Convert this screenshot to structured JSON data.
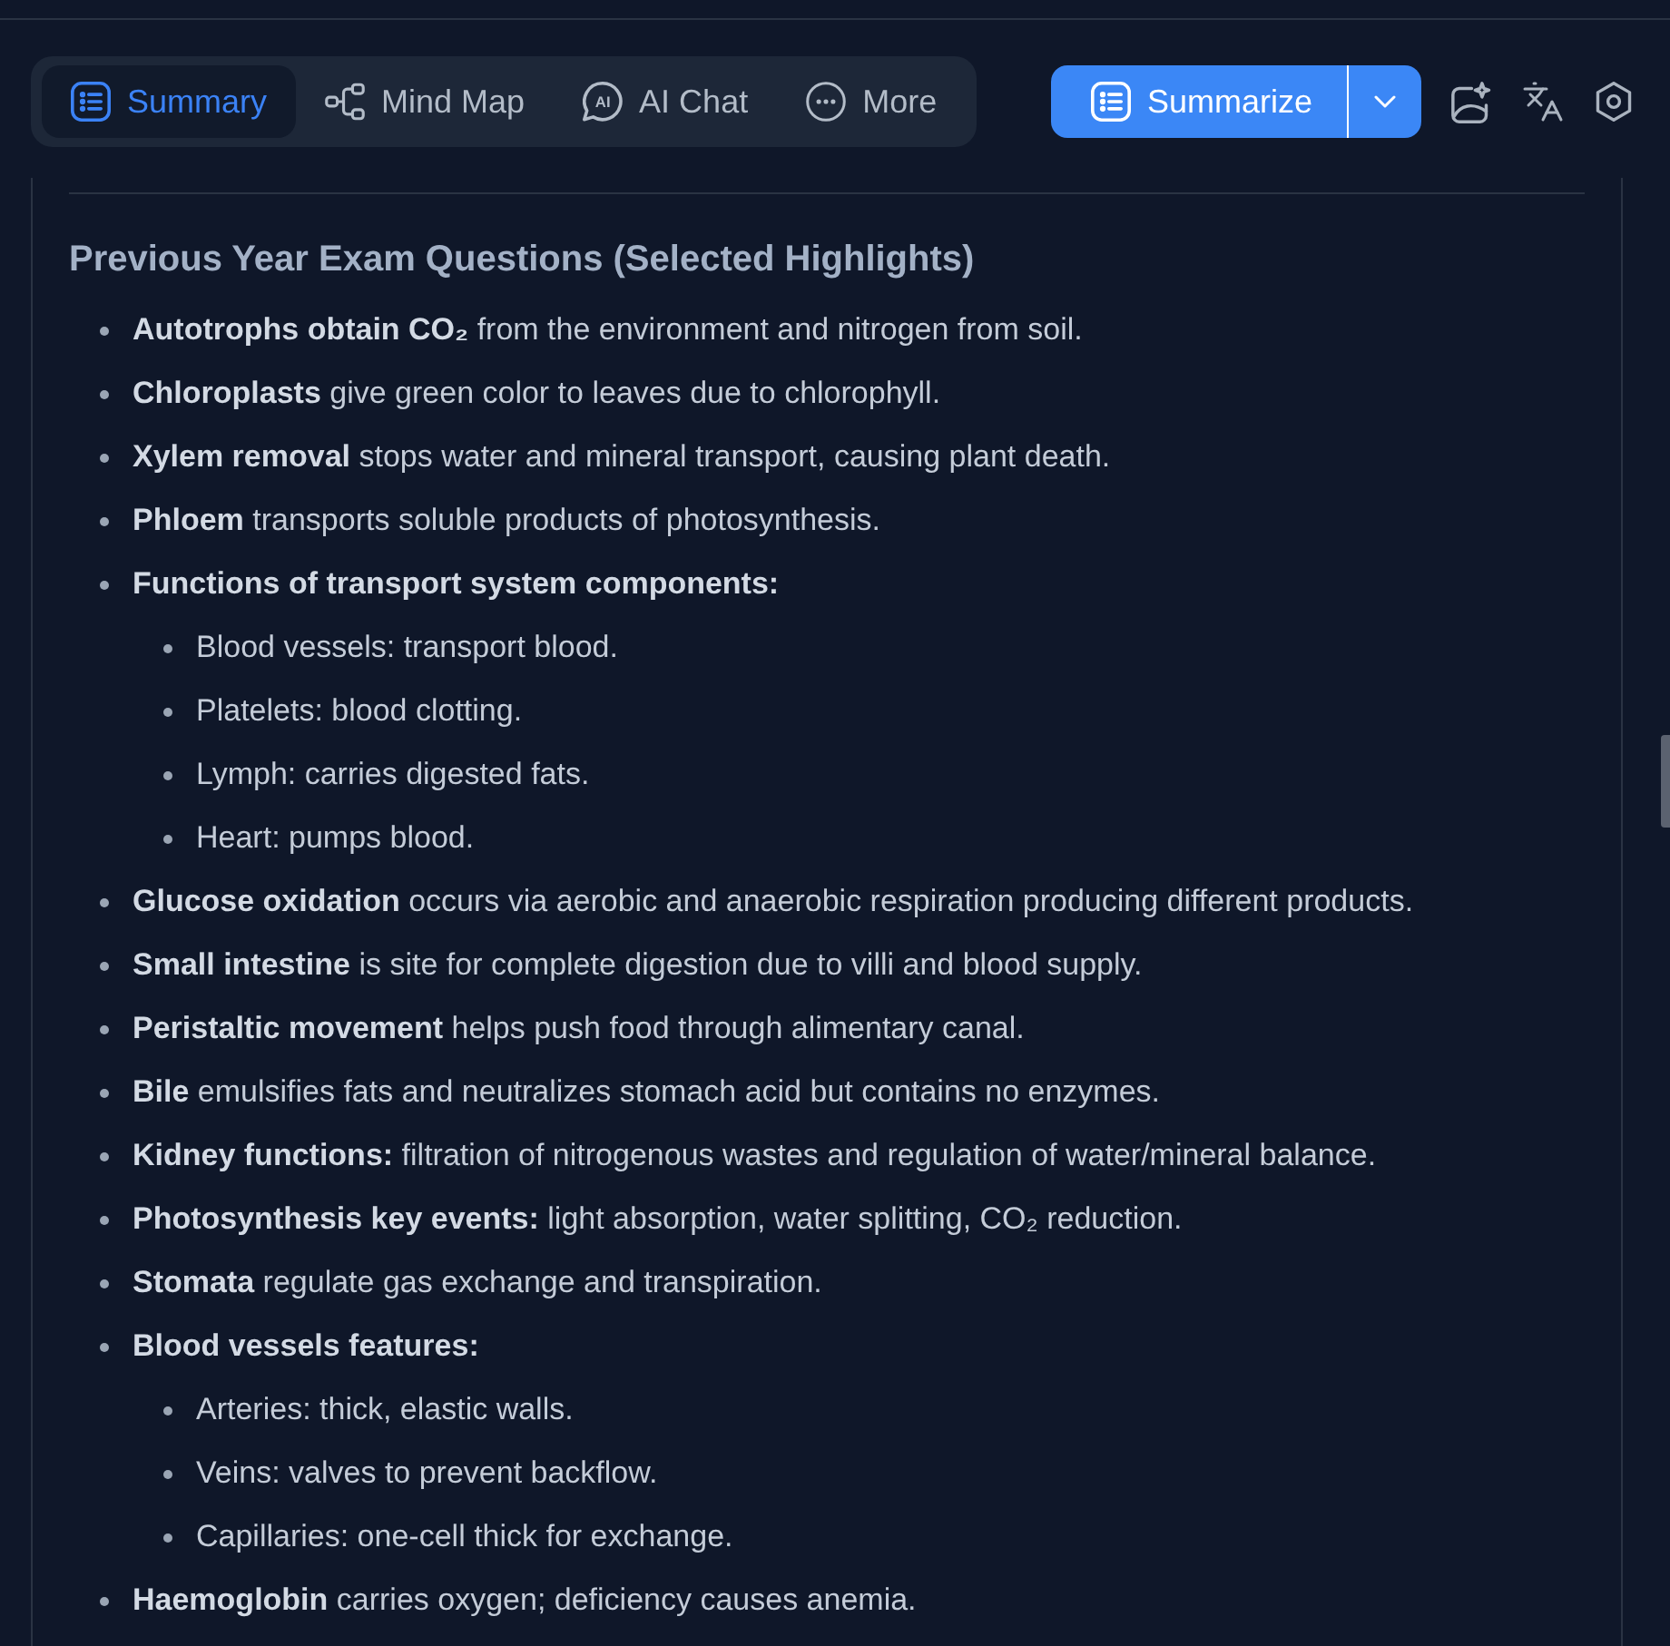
{
  "tabs": [
    {
      "label": "Summary",
      "selected": true
    },
    {
      "label": "Mind Map",
      "selected": false
    },
    {
      "label": "AI Chat",
      "selected": false,
      "icon_text": "AI"
    },
    {
      "label": "More",
      "selected": false
    }
  ],
  "summarize_button": {
    "label": "Summarize"
  },
  "summary": {
    "heading": "Previous Year Exam Questions (Selected Highlights)",
    "items": [
      {
        "text": "**Autotrophs obtain CO₂** from the environment and nitrogen from soil."
      },
      {
        "text": "**Chloroplasts** give green color to leaves due to chlorophyll."
      },
      {
        "text": "**Xylem removal** stops water and mineral transport, causing plant death."
      },
      {
        "text": "**Phloem** transports soluble products of photosynthesis."
      },
      {
        "text": "**Functions of transport system components:**",
        "children": [
          {
            "text": "Blood vessels: transport blood."
          },
          {
            "text": "Platelets: blood clotting."
          },
          {
            "text": "Lymph: carries digested fats."
          },
          {
            "text": "Heart: pumps blood."
          }
        ]
      },
      {
        "text": "**Glucose oxidation** occurs via aerobic and anaerobic respiration producing different products."
      },
      {
        "text": "**Small intestine** is site for complete digestion due to villi and blood supply."
      },
      {
        "text": "**Peristaltic movement** helps push food through alimentary canal."
      },
      {
        "text": "**Bile** emulsifies fats and neutralizes stomach acid but contains no enzymes."
      },
      {
        "text": "**Kidney functions:** filtration of nitrogenous wastes and regulation of water/mineral balance."
      },
      {
        "text": "**Photosynthesis key events:** light absorption, water splitting, CO₂ reduction."
      },
      {
        "text": "**Stomata** regulate gas exchange and transpiration."
      },
      {
        "text": "**Blood vessels features:**",
        "children": [
          {
            "text": "Arteries: thick, elastic walls."
          },
          {
            "text": "Veins: valves to prevent backflow."
          },
          {
            "text": "Capillaries: one-cell thick for exchange."
          }
        ]
      },
      {
        "text": "**Haemoglobin** carries oxygen; deficiency causes anemia."
      }
    ]
  }
}
